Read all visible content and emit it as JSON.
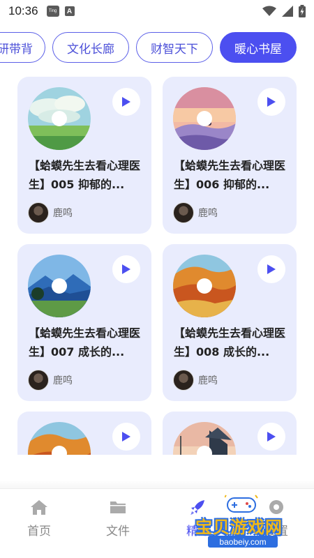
{
  "status_bar": {
    "time": "10:36",
    "app_badge": "Ting",
    "notification_letter": "A",
    "icons": [
      "wifi-icon",
      "signal-icon",
      "battery-charging-icon"
    ]
  },
  "category_tabs": [
    {
      "label": "研带背",
      "active": false
    },
    {
      "label": "文化长廊",
      "active": false
    },
    {
      "label": "财智天下",
      "active": false
    },
    {
      "label": "暖心书屋",
      "active": true
    }
  ],
  "cards": [
    {
      "title": "【蛤蟆先生去看心理医生】005 抑郁的...",
      "author": "鹿鸣",
      "cover": "meadow-clouds"
    },
    {
      "title": "【蛤蟆先生去看心理医生】006 抑郁的...",
      "author": "鹿鸣",
      "cover": "sunset-hill"
    },
    {
      "title": "【蛤蟆先生去看心理医生】007 成长的...",
      "author": "鹿鸣",
      "cover": "blue-mountains"
    },
    {
      "title": "【蛤蟆先生去看心理医生】008 成长的...",
      "author": "鹿鸣",
      "cover": "autumn-trees"
    },
    {
      "title": "",
      "author": "",
      "cover": "autumn-trees"
    },
    {
      "title": "",
      "author": "",
      "cover": "house-dusk"
    }
  ],
  "bottom_nav": [
    {
      "label": "首页",
      "icon": "home-icon",
      "active": false
    },
    {
      "label": "文件",
      "icon": "folder-icon",
      "active": false
    },
    {
      "label": "精选",
      "icon": "rocket-icon",
      "active": true
    },
    {
      "label": "设置",
      "icon": "settings-icon",
      "active": false
    }
  ],
  "watermark": {
    "title": "宝贝游戏网",
    "url": "baobeiy.com"
  },
  "colors": {
    "accent": "#4c4ff0",
    "card_bg": "#e9ecfd"
  }
}
